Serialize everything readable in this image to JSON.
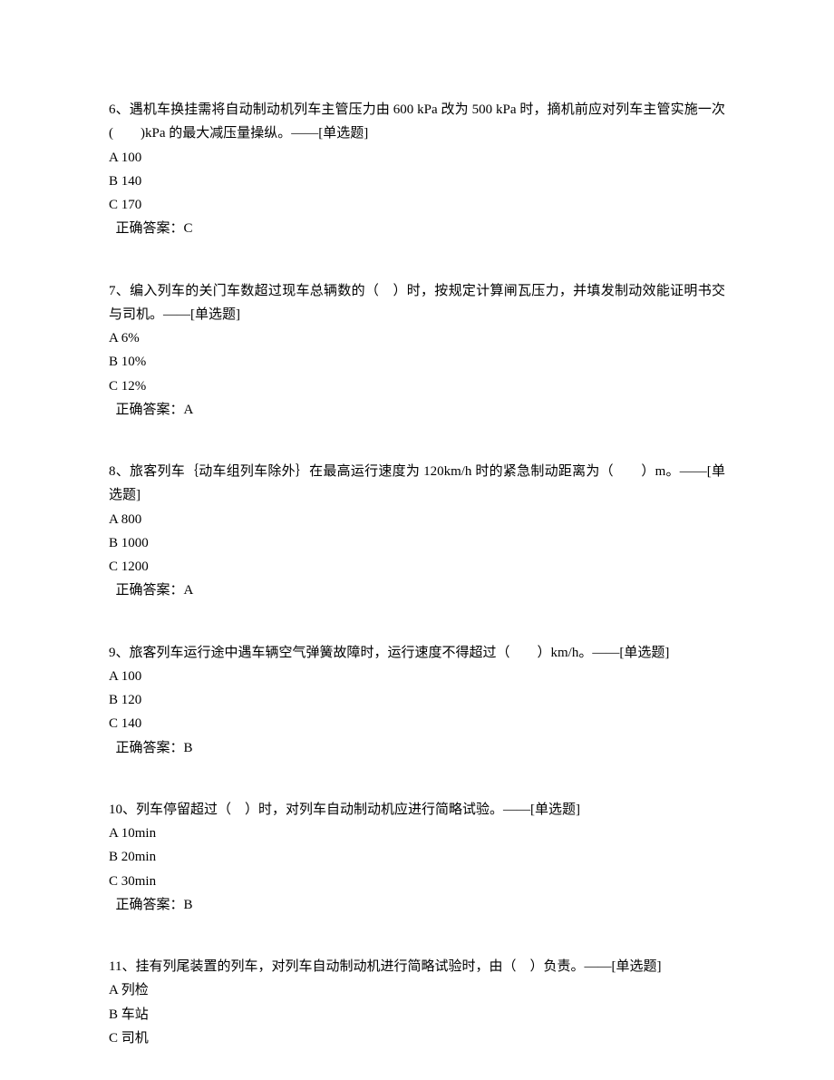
{
  "questions": [
    {
      "text": "6、遇机车换挂需将自动制动机列车主管压力由 600 kPa 改为 500 kPa 时，摘机前应对列车主管实施一次(　　)kPa 的最大减压量操纵。——[单选题]",
      "options": [
        "A 100",
        "B 140",
        "C 170"
      ],
      "answer": "正确答案：C"
    },
    {
      "text": "7、编入列车的关门车数超过现车总辆数的（　）时，按规定计算闸瓦压力，并填发制动效能证明书交与司机。——[单选题]",
      "options": [
        "A 6%",
        "B 10%",
        "C 12%"
      ],
      "answer": "正确答案：A"
    },
    {
      "text": "8、旅客列车｛动车组列车除外｝在最高运行速度为 120km/h 时的紧急制动距离为（　　）m。——[单选题]",
      "options": [
        "A 800",
        "B 1000",
        "C 1200"
      ],
      "answer": "正确答案：A"
    },
    {
      "text": "9、旅客列车运行途中遇车辆空气弹簧故障时，运行速度不得超过（　　）km/h。——[单选题]",
      "options": [
        "A 100",
        "B 120",
        "C 140"
      ],
      "answer": "正确答案：B"
    },
    {
      "text": "10、列车停留超过（　）时，对列车自动制动机应进行简略试验。——[单选题]",
      "options": [
        "A 10min",
        "B 20min",
        "C 30min"
      ],
      "answer": "正确答案：B"
    },
    {
      "text": "11、挂有列尾装置的列车，对列车自动制动机进行简略试验时，由（　）负责。——[单选题]",
      "options": [
        "A 列检",
        "B 车站",
        "C 司机"
      ],
      "answer": ""
    }
  ]
}
